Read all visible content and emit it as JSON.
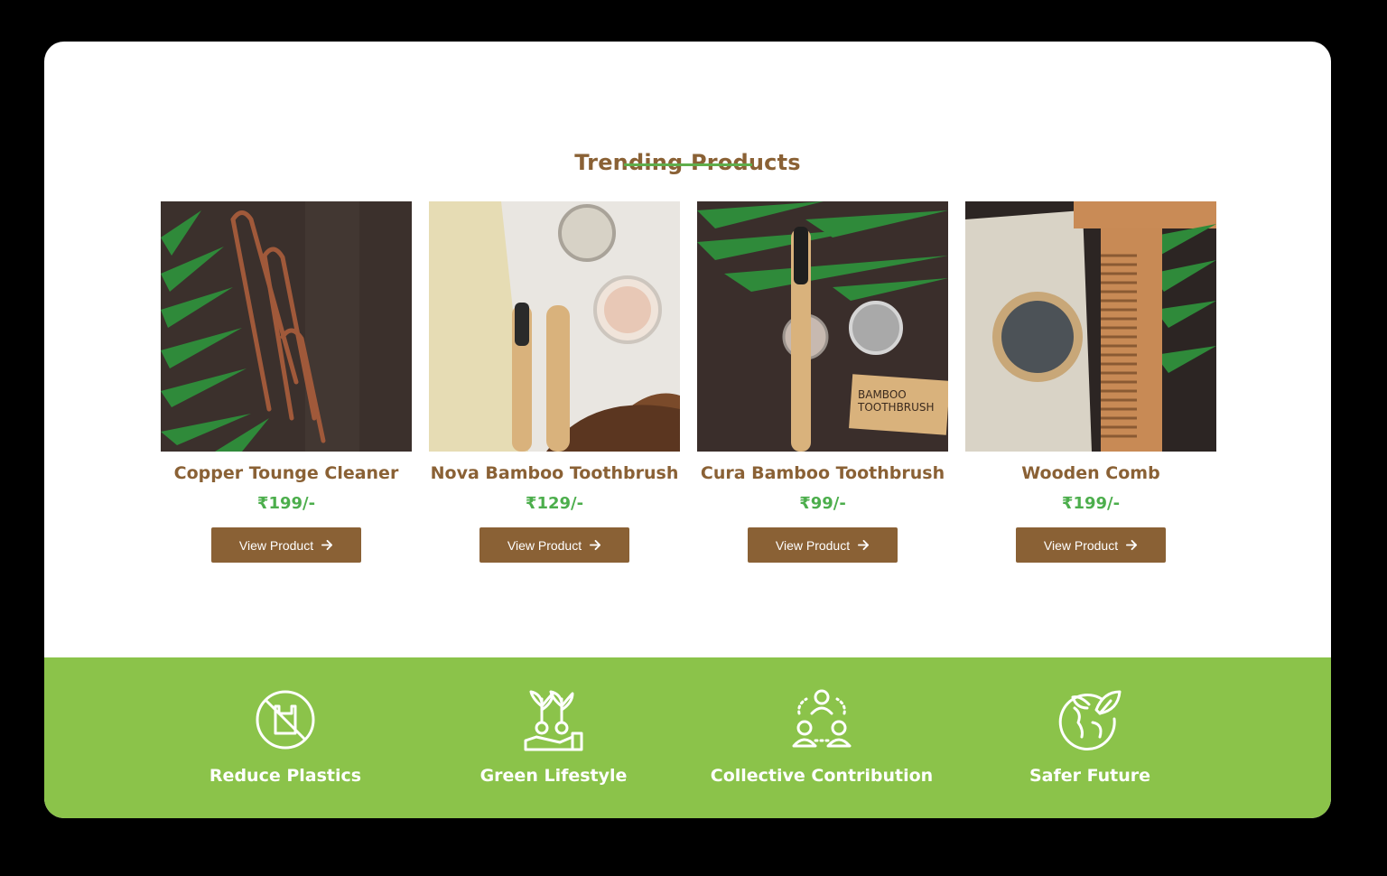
{
  "section": {
    "title": "Trending Products"
  },
  "products": [
    {
      "name": "Copper Tounge Cleaner",
      "price": "₹199/-",
      "button": "View Product"
    },
    {
      "name": "Nova Bamboo Toothbrush",
      "price": "₹129/-",
      "button": "View Product"
    },
    {
      "name": "Cura Bamboo Toothbrush",
      "price": "₹99/-",
      "button": "View Product"
    },
    {
      "name": "Wooden Comb",
      "price": "₹199/-",
      "button": "View Product"
    }
  ],
  "images": {
    "p3_label_line1": "BAMBOO",
    "p3_label_line2": "TOOTHBRUSH"
  },
  "features": [
    {
      "label": "Reduce Plastics",
      "icon": "no-plastic-bag-icon"
    },
    {
      "label": "Green Lifestyle",
      "icon": "plant-hand-icon"
    },
    {
      "label": "Collective Contribution",
      "icon": "community-icon"
    },
    {
      "label": "Safer Future",
      "icon": "globe-leaf-icon"
    }
  ],
  "colors": {
    "brown": "#8a6135",
    "price_green": "#4cae4c",
    "banner_green": "#8bc34a",
    "underline_green": "#5fae4c"
  }
}
